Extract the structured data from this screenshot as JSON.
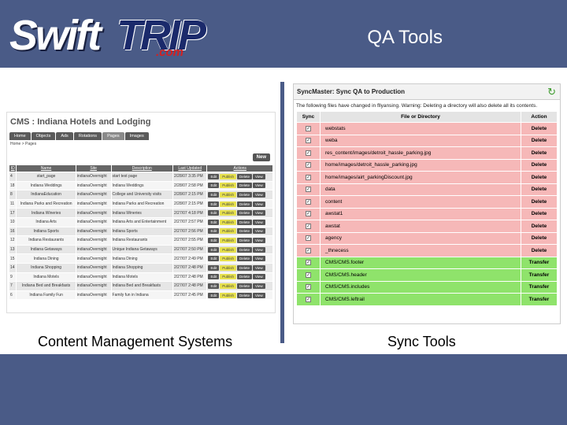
{
  "header": {
    "logo": {
      "word1": "Swift",
      "word2": "TRIP",
      "suffix": ".com"
    },
    "title": "QA Tools"
  },
  "captions": {
    "left": "Content Management Systems",
    "right": "Sync Tools"
  },
  "cms": {
    "title": "CMS : Indiana Hotels and Lodging",
    "tabs": [
      "Home",
      "Objects",
      "Ads",
      "Rotations",
      "Pages",
      "Images"
    ],
    "active_tab": "Pages",
    "breadcrumb": "Home > Pages",
    "new_button": "New",
    "columns": [
      "ID",
      "Name",
      "Site",
      "Description",
      "Last Updated",
      "Actions"
    ],
    "action_labels": {
      "edit": "Edit",
      "publish": "Publish",
      "delete": "Delete",
      "view": "View"
    },
    "rows": [
      {
        "id": "4",
        "name": "start_page",
        "site": "indianaOvernight",
        "description": "start test page",
        "updated": "2/28/07 3:35 PM"
      },
      {
        "id": "18",
        "name": "Indiana Weddings",
        "site": "indianaOvernight",
        "description": "Indiana Weddings",
        "updated": "2/28/07 2:58 PM"
      },
      {
        "id": "8",
        "name": "IndianaEducation",
        "site": "indianaOvernight",
        "description": "College and University visits",
        "updated": "2/28/07 2:15 PM"
      },
      {
        "id": "11",
        "name": "Indiana Parks and Recreation",
        "site": "indianaOvernight",
        "description": "Indiana Parks and Recreation",
        "updated": "2/28/07 2:15 PM"
      },
      {
        "id": "17",
        "name": "Indiana Wineries",
        "site": "indianaOvernight",
        "description": "Indiana Wineries",
        "updated": "2/27/07 4:18 PM"
      },
      {
        "id": "10",
        "name": "Indiana Arts",
        "site": "indianaOvernight",
        "description": "Indiana Arts and Entertainment",
        "updated": "2/27/07 2:57 PM"
      },
      {
        "id": "16",
        "name": "Indiana Sports",
        "site": "indianaOvernight",
        "description": "Indiana Sports",
        "updated": "2/27/07 2:56 PM"
      },
      {
        "id": "12",
        "name": "Indiana Restaurants",
        "site": "indianaOvernight",
        "description": "Indiana Restaurants",
        "updated": "2/27/07 2:55 PM"
      },
      {
        "id": "13",
        "name": "Indiana Getaways",
        "site": "indianaOvernight",
        "description": "Unique Indiana Getaways",
        "updated": "2/27/07 2:50 PM"
      },
      {
        "id": "15",
        "name": "Indiana Dining",
        "site": "indianaOvernight",
        "description": "Indiana Dining",
        "updated": "2/27/07 2:49 PM"
      },
      {
        "id": "14",
        "name": "Indiana Shopping",
        "site": "indianaOvernight",
        "description": "Indiana Shopping",
        "updated": "2/27/07 2:48 PM"
      },
      {
        "id": "9",
        "name": "Indiana Motels",
        "site": "indianaOvernight",
        "description": "Indiana Motels",
        "updated": "2/27/07 2:48 PM"
      },
      {
        "id": "7",
        "name": "Indiana Bed and Breakfasts",
        "site": "indianaOvernight",
        "description": "Indiana Bed and Breakfasts",
        "updated": "2/27/07 2:48 PM"
      },
      {
        "id": "6",
        "name": "Indiana Family Fun",
        "site": "indianaOvernight",
        "description": "Family fun in Indiana",
        "updated": "2/27/07 2:45 PM"
      }
    ]
  },
  "sync": {
    "title": "SyncMaster: Sync QA to Production",
    "warning": "The following files have changed in fllyansing. Warning: Deleting a directory will also delete all its contents.",
    "columns": [
      "Sync",
      "File or Directory",
      "Action"
    ],
    "check_glyph": "✓",
    "rows": [
      {
        "path": "webstats",
        "action": "Delete",
        "type": "delete"
      },
      {
        "path": "weba",
        "action": "Delete",
        "type": "delete"
      },
      {
        "path": "res_content/images/detroit_hassle_parking.jpg",
        "action": "Delete",
        "type": "delete"
      },
      {
        "path": "home/images/detroit_hassle_parking.jpg",
        "action": "Delete",
        "type": "delete"
      },
      {
        "path": "home/images/airt_parkingDiscount.jpg",
        "action": "Delete",
        "type": "delete"
      },
      {
        "path": "data",
        "action": "Delete",
        "type": "delete"
      },
      {
        "path": "content",
        "action": "Delete",
        "type": "delete"
      },
      {
        "path": "awstat1",
        "action": "Delete",
        "type": "delete"
      },
      {
        "path": "awstat",
        "action": "Delete",
        "type": "delete"
      },
      {
        "path": "agency",
        "action": "Delete",
        "type": "delete"
      },
      {
        "path": "_thnecess",
        "action": "Delete",
        "type": "delete"
      },
      {
        "path": "CMS/CMS.footer",
        "action": "Transfer",
        "type": "transfer"
      },
      {
        "path": "CMS/CMS.header",
        "action": "Transfer",
        "type": "transfer"
      },
      {
        "path": "CMS/CMS.includes",
        "action": "Transfer",
        "type": "transfer"
      },
      {
        "path": "CMS/CMS.leftrail",
        "action": "Transfer",
        "type": "transfer"
      }
    ]
  }
}
